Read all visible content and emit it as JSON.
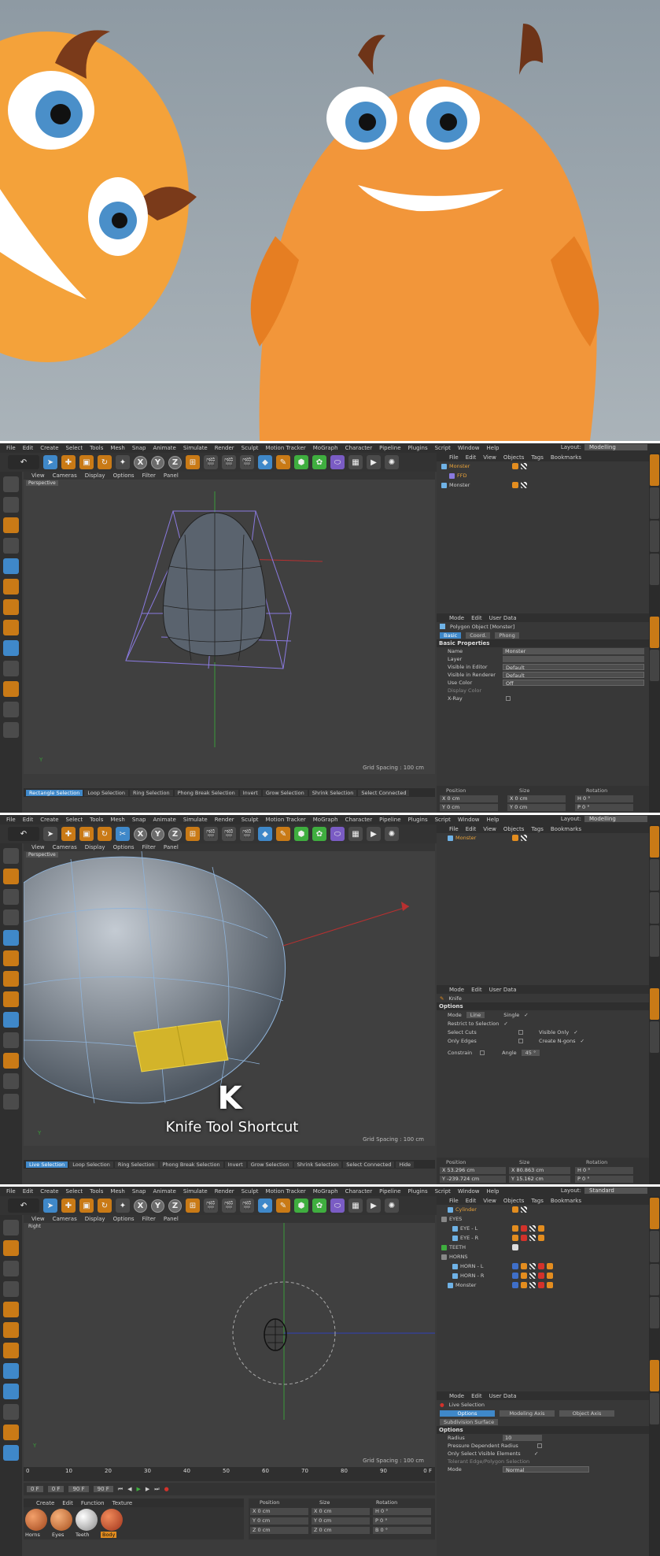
{
  "menus": [
    "File",
    "Edit",
    "Create",
    "Select",
    "Tools",
    "Mesh",
    "Snap",
    "Animate",
    "Simulate",
    "Render",
    "Sculpt",
    "Motion Tracker",
    "MoGraph",
    "Character",
    "Pipeline",
    "Plugins",
    "Script",
    "Window",
    "Help"
  ],
  "panel1": {
    "layout_label": "Layout:",
    "layout_value": "Modelling",
    "viewport_menu": [
      "View",
      "Cameras",
      "Display",
      "Options",
      "Filter",
      "Panel"
    ],
    "viewport_title": "Perspective",
    "grid_spacing": "Grid Spacing : 100 cm",
    "object_menu": [
      "File",
      "Edit",
      "View",
      "Objects",
      "Tags",
      "Bookmarks"
    ],
    "objects": [
      {
        "name": "Monster",
        "highlight": true
      },
      {
        "name": "FFD",
        "highlight": true
      },
      {
        "name": "Monster",
        "highlight": false
      }
    ],
    "attr_menu": [
      "Mode",
      "Edit",
      "User Data"
    ],
    "attr_title": "Polygon Object [Monster]",
    "attr_tabs": [
      "Basic",
      "Coord.",
      "Phong"
    ],
    "section": "Basic Properties",
    "props": [
      {
        "label": "Name",
        "value": "Monster"
      },
      {
        "label": "Layer",
        "value": ""
      },
      {
        "label": "Visible in Editor",
        "value": "Default"
      },
      {
        "label": "Visible in Renderer",
        "value": "Default"
      },
      {
        "label": "Use Color",
        "value": "Off"
      },
      {
        "label": "Display Color",
        "value": ""
      },
      {
        "label": "X-Ray",
        "value": ""
      }
    ],
    "coords_headers": [
      "Position",
      "Size",
      "Rotation"
    ],
    "coords": [
      [
        "X",
        "0 cm",
        "X",
        "0 cm",
        "H",
        "0 °"
      ],
      [
        "Y",
        "0 cm",
        "Y",
        "0 cm",
        "P",
        "0 °"
      ]
    ],
    "select_tools": [
      "Rectangle Selection",
      "Loop Selection",
      "Ring Selection",
      "Phong Break Selection",
      "Invert",
      "Grow Selection",
      "Shrink Selection",
      "Select Connected"
    ]
  },
  "panel2": {
    "layout_label": "Layout:",
    "layout_value": "Modelling",
    "viewport_title": "Perspective",
    "grid_spacing": "Grid Spacing : 100 cm",
    "objects": [
      {
        "name": "Monster",
        "highlight": true
      }
    ],
    "attr_tool": "Knife",
    "section": "Options",
    "mode_label": "Mode",
    "mode_value": "Line",
    "single_label": "Single",
    "options_left": [
      "Restrict to Selection",
      "Select Cuts",
      "Only Edges"
    ],
    "options_right": [
      "",
      "Visible Only",
      "Create N-gons"
    ],
    "constrain_label": "Constrain",
    "angle_label": "Angle",
    "angle_value": "45 °",
    "coords_headers": [
      "Position",
      "Size",
      "Rotation"
    ],
    "coords": [
      [
        "X",
        "53.296 cm",
        "X",
        "80.863 cm",
        "H",
        "0 °"
      ],
      [
        "Y",
        "-239.724 cm",
        "Y",
        "15.162 cm",
        "P",
        "0 °"
      ]
    ],
    "select_tools": [
      "Live Selection",
      "Loop Selection",
      "Ring Selection",
      "Phong Break Selection",
      "Invert",
      "Grow Selection",
      "Shrink Selection",
      "Select Connected",
      "Hide"
    ],
    "overlay_key": "K",
    "overlay_caption": "Knife Tool Shortcut"
  },
  "panel3": {
    "layout_label": "Layout:",
    "layout_value": "Standard",
    "viewport_title": "Right",
    "grid_spacing": "Grid Spacing : 100 cm",
    "objects": [
      {
        "name": "Cylinder",
        "highlight": true
      },
      {
        "name": "EYES",
        "highlight": false
      },
      {
        "name": "EYE - L",
        "highlight": false
      },
      {
        "name": "EYE - R",
        "highlight": false
      },
      {
        "name": "TEETH",
        "highlight": false
      },
      {
        "name": "HORNS",
        "highlight": false
      },
      {
        "name": "HORN - L",
        "highlight": false
      },
      {
        "name": "HORN - R",
        "highlight": false
      },
      {
        "name": "Monster",
        "highlight": false
      }
    ],
    "attr_tool": "Live Selection",
    "attr_tabs": [
      "Options",
      "Modeling Axis",
      "Object Axis"
    ],
    "attr_subtab": "Subdivision Surface",
    "section": "Options",
    "props": [
      {
        "label": "Radius",
        "value": "10"
      },
      {
        "label": "Pressure Dependent Radius",
        "value": ""
      },
      {
        "label": "Only Select Visible Elements",
        "value": ""
      },
      {
        "label": "Tolerant Edge/Polygon Selection",
        "value": ""
      },
      {
        "label": "Mode",
        "value": "Normal"
      }
    ],
    "timeline_ticks": [
      "0",
      "10",
      "20",
      "30",
      "40",
      "50",
      "60",
      "70",
      "80",
      "90"
    ],
    "frame_start": "0 F",
    "frame_current": "0 F",
    "frame_end": "90 F",
    "frame_end2": "90 F",
    "mat_menu": [
      "Create",
      "Edit",
      "Function",
      "Texture"
    ],
    "materials": [
      "Horns",
      "Eyes",
      "Teeth",
      "Body"
    ],
    "coords_headers": [
      "Position",
      "Size",
      "Rotation"
    ],
    "coords": [
      [
        "X",
        "0 cm",
        "X",
        "0 cm",
        "H",
        "0 °"
      ],
      [
        "Y",
        "0 cm",
        "Y",
        "0 cm",
        "P",
        "0 °"
      ],
      [
        "Z",
        "0 cm",
        "Z",
        "0 cm",
        "B",
        "0 °"
      ]
    ]
  },
  "colors": {
    "accent": "#3f88c9",
    "orange": "#c97a16",
    "bg": "#3b3b3b"
  }
}
